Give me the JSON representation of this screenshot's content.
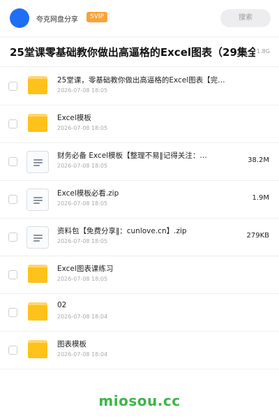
{
  "header": {
    "username": "夸克网盘分享",
    "badge": "SVIP",
    "search_label": "搜索"
  },
  "share": {
    "title": "25堂课零基础教你做出高逼格的Excel图表（29集全）",
    "size": "1.8G"
  },
  "files": [
    {
      "type": "folder",
      "icon": "folder-icon",
      "name": "25堂课，零基础教你做出高逼格的Excel图表【完…",
      "date": "2026-07-08 18:05",
      "size": ""
    },
    {
      "type": "folder",
      "icon": "folder-icon",
      "name": "Excel模板",
      "date": "2026-07-08 18:05",
      "size": ""
    },
    {
      "type": "file",
      "icon": "document-icon",
      "name": "财务必备 Excel模板【整理不易‖记得关注：…",
      "date": "2026-07-08 18:05",
      "size": "38.2M"
    },
    {
      "type": "file",
      "icon": "document-icon",
      "name": "Excel模板必看.zip",
      "date": "2026-07-08 18:05",
      "size": "1.9M"
    },
    {
      "type": "file",
      "icon": "document-icon",
      "name": "资料包【免费分享‖：cunlove.cn】.zip",
      "date": "2026-07-08 18:05",
      "size": "279KB"
    },
    {
      "type": "folder",
      "icon": "folder-icon",
      "name": "Excel图表课练习",
      "date": "2026-07-08 18:05",
      "size": ""
    },
    {
      "type": "folder",
      "icon": "folder-icon",
      "name": "02",
      "date": "2026-07-08 18:04",
      "size": ""
    },
    {
      "type": "folder",
      "icon": "folder-icon",
      "name": "图表模板",
      "date": "2026-07-08 18:04",
      "size": ""
    }
  ],
  "footer": {
    "watermark": "miosou.cc"
  },
  "colors": {
    "avatar": "#1e6ff5",
    "badge": "#f9a33a",
    "folder": "#ffc21a",
    "watermark": "#3fb449"
  }
}
